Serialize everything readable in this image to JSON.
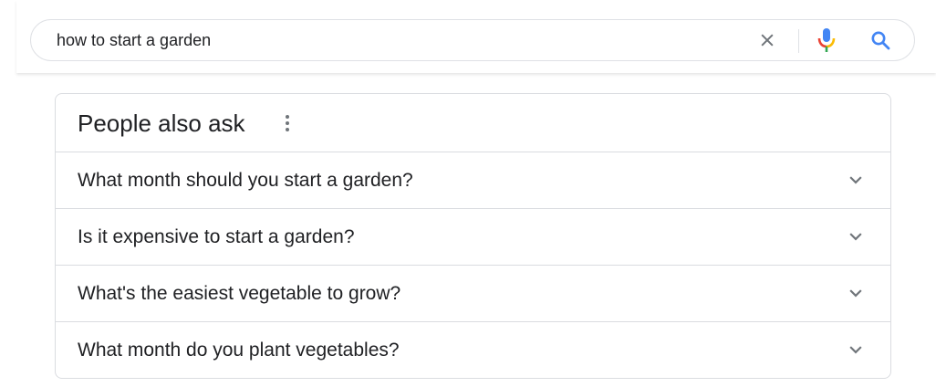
{
  "search": {
    "query": "how to start a garden",
    "clear_icon": "close-icon",
    "mic_icon": "microphone-icon",
    "search_icon": "search-icon"
  },
  "people_also_ask": {
    "title": "People also ask",
    "menu_icon": "more-vert-icon",
    "questions": [
      {
        "text": "What month should you start a garden?",
        "icon": "chevron-down-icon"
      },
      {
        "text": "Is it expensive to start a garden?",
        "icon": "chevron-down-icon"
      },
      {
        "text": "What's the easiest vegetable to grow?",
        "icon": "chevron-down-icon"
      },
      {
        "text": "What month do you plant vegetables?",
        "icon": "chevron-down-icon"
      }
    ]
  },
  "colors": {
    "icon_gray": "#70757a",
    "search_blue": "#4285f4",
    "mic_blue": "#4285f4",
    "mic_red": "#ea4335",
    "mic_yellow": "#fbbc05",
    "mic_green": "#34a853",
    "border": "#dadce0",
    "text": "#202124"
  }
}
